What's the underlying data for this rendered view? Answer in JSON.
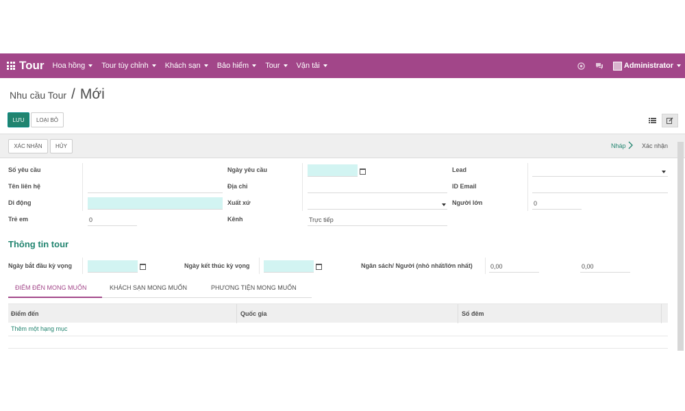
{
  "app": {
    "title": "Tour"
  },
  "menu": [
    "Hoa hồng",
    "Tour tùy chỉnh",
    "Khách sạn",
    "Bảo hiểm",
    "Tour",
    "Vận tải"
  ],
  "user": {
    "name": "Administrator"
  },
  "breadcrumb": {
    "parent": "Nhu cầu Tour",
    "separator": "/",
    "current": "Mới"
  },
  "actions": {
    "save": "LƯU",
    "discard": "LOẠI BỎ"
  },
  "statusbar": {
    "confirm": "XÁC NHẬN",
    "cancel": "HỦY",
    "stages": {
      "draft": "Nháp",
      "confirmed": "Xác nhận"
    }
  },
  "form": {
    "request_no": {
      "label": "Số yêu cầu",
      "value": ""
    },
    "request_date": {
      "label": "Ngày yêu cầu",
      "value": ""
    },
    "lead": {
      "label": "Lead",
      "value": ""
    },
    "contact_name": {
      "label": "Tên liên hệ",
      "value": ""
    },
    "address": {
      "label": "Địa chỉ",
      "value": ""
    },
    "email": {
      "label": "ID Email",
      "value": ""
    },
    "mobile": {
      "label": "Di động",
      "value": ""
    },
    "origin": {
      "label": "Xuất xứ",
      "value": ""
    },
    "adults": {
      "label": "Người lớn",
      "value": "0"
    },
    "children": {
      "label": "Trẻ em",
      "value": "0"
    },
    "channel": {
      "label": "Kênh",
      "value": "Trực tiếp"
    }
  },
  "tour_info": {
    "title": "Thông tin tour",
    "start_date": {
      "label": "Ngày bắt đầu kỳ vọng",
      "value": ""
    },
    "end_date": {
      "label": "Ngày kết thúc kỳ vọng",
      "value": ""
    },
    "budget": {
      "label": "Ngân sách/ Người (nhỏ nhất/lớn nhất)",
      "min": "0,00",
      "max": "0,00"
    }
  },
  "tabs": [
    "ĐIỂM ĐẾN MONG MUỐN",
    "KHÁCH SẠN MONG MUỐN",
    "PHƯƠNG TIỆN MONG MUỐN"
  ],
  "table": {
    "columns": [
      "Điểm đến",
      "Quốc gia",
      "Số đêm"
    ],
    "add_line": "Thêm một hạng mục"
  },
  "colors": {
    "navbar": "#a24689",
    "primary": "#21846f",
    "required": "#d2f4f2"
  }
}
